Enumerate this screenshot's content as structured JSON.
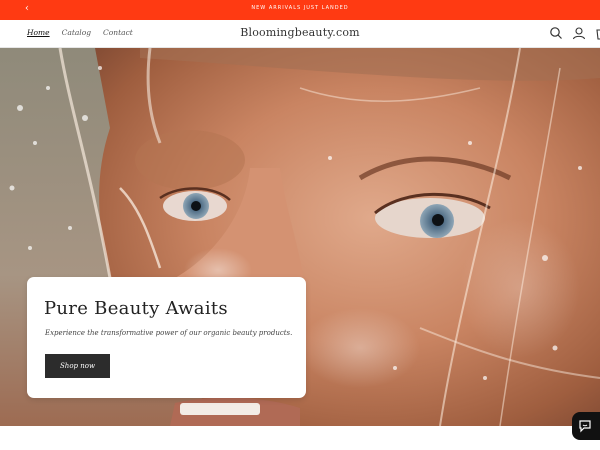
{
  "announcement": {
    "text": "New arrivals just landed"
  },
  "header": {
    "nav": [
      "Home",
      "Catalog",
      "Contact"
    ],
    "brand": "Bloomingbeauty.com",
    "icons": [
      "search-icon",
      "account-icon",
      "cart-icon"
    ]
  },
  "hero": {
    "image": "portrait-water-splash",
    "title": "Pure Beauty Awaits",
    "subtitle": "Experience the transformative power of our organic beauty products.",
    "button_label": "Shop now"
  },
  "chat": {
    "icon": "chat-icon"
  },
  "colors": {
    "announcement_bg": "#ff3a12",
    "button_bg": "#2c2c2c",
    "chat_bg": "#111111"
  }
}
